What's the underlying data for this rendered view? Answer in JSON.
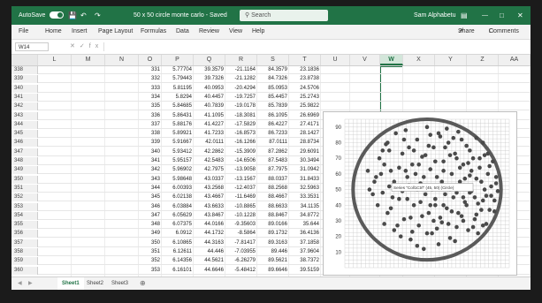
{
  "app": {
    "autosave_label": "AutoSave",
    "toggle_state": "On",
    "title": "50 x 50 circle monte carlo - Saved",
    "search_placeholder": "Search",
    "user": "Sam Alphabetu"
  },
  "menu": [
    "File",
    "Home",
    "Insert",
    "Page Layout",
    "Formulas",
    "Data",
    "Review",
    "View",
    "Help"
  ],
  "share_label": "Share",
  "comments_label": "Comments",
  "formula_bar": {
    "name_box": "W14",
    "formula": ""
  },
  "columns": [
    "L",
    "M",
    "N",
    "O",
    "P",
    "Q",
    "R",
    "S",
    "T",
    "U",
    "V",
    "W",
    "X",
    "Y",
    "Z",
    "AA"
  ],
  "selected_column": "W",
  "rows": [
    {
      "n": "338",
      "o": "331",
      "p": "5.77704",
      "q": "39.3579",
      "r": "-21.1164",
      "s": "84.3579",
      "t": "23.1836"
    },
    {
      "n": "339",
      "o": "332",
      "p": "5.79443",
      "q": "39.7326",
      "r": "-21.1282",
      "s": "84.7326",
      "t": "23.8738"
    },
    {
      "n": "340",
      "o": "333",
      "p": "5.81195",
      "q": "40.0953",
      "r": "-20.4294",
      "s": "85.0953",
      "t": "24.5706"
    },
    {
      "n": "341",
      "o": "334",
      "p": "5.8294",
      "q": "40.4457",
      "r": "-19.7257",
      "s": "85.4457",
      "t": "25.2743"
    },
    {
      "n": "342",
      "o": "335",
      "p": "5.84685",
      "q": "40.7839",
      "r": "-19.0178",
      "s": "85.7839",
      "t": "25.9822"
    },
    {
      "n": "343",
      "o": "336",
      "p": "5.86431",
      "q": "41.1095",
      "r": "-18.3081",
      "s": "86.1095",
      "t": "26.6969"
    },
    {
      "n": "344",
      "o": "337",
      "p": "5.88176",
      "q": "41.4227",
      "r": "-17.5829",
      "s": "86.4227",
      "t": "27.4171"
    },
    {
      "n": "345",
      "o": "338",
      "p": "5.89921",
      "q": "41.7233",
      "r": "-16.8573",
      "s": "86.7233",
      "t": "28.1427"
    },
    {
      "n": "346",
      "o": "339",
      "p": "5.91667",
      "q": "42.0111",
      "r": "-16.1266",
      "s": "87.0111",
      "t": "28.8734"
    },
    {
      "n": "347",
      "o": "340",
      "p": "5.93412",
      "q": "42.2862",
      "r": "-15.3909",
      "s": "87.2862",
      "t": "29.6091"
    },
    {
      "n": "348",
      "o": "341",
      "p": "5.95157",
      "q": "42.5483",
      "r": "-14.6506",
      "s": "87.5483",
      "t": "30.3494"
    },
    {
      "n": "349",
      "o": "342",
      "p": "5.96902",
      "q": "42.7975",
      "r": "-13.9058",
      "s": "87.7975",
      "t": "31.0942"
    },
    {
      "n": "350",
      "o": "343",
      "p": "5.98648",
      "q": "43.0337",
      "r": "-13.1567",
      "s": "88.0337",
      "t": "31.8433"
    },
    {
      "n": "351",
      "o": "344",
      "p": "6.00393",
      "q": "43.2568",
      "r": "-12.4037",
      "s": "88.2568",
      "t": "32.5963"
    },
    {
      "n": "352",
      "o": "345",
      "p": "6.02138",
      "q": "43.4667",
      "r": "-11.6469",
      "s": "88.4667",
      "t": "33.3531"
    },
    {
      "n": "353",
      "o": "346",
      "p": "6.03884",
      "q": "43.6633",
      "r": "-10.8865",
      "s": "88.6633",
      "t": "34.1135"
    },
    {
      "n": "354",
      "o": "347",
      "p": "6.05629",
      "q": "43.8467",
      "r": "-10.1228",
      "s": "88.8467",
      "t": "34.8772"
    },
    {
      "n": "355",
      "o": "348",
      "p": "6.07375",
      "q": "44.0166",
      "r": "-9.35603",
      "s": "89.0166",
      "t": "35.644"
    },
    {
      "n": "356",
      "o": "349",
      "p": "6.0912",
      "q": "44.1732",
      "r": "-8.5864",
      "s": "89.1732",
      "t": "36.4136"
    },
    {
      "n": "357",
      "o": "350",
      "p": "6.10865",
      "q": "44.3163",
      "r": "-7.81417",
      "s": "89.3163",
      "t": "37.1858"
    },
    {
      "n": "358",
      "o": "351",
      "p": "6.12611",
      "q": "44.446",
      "r": "-7.03955",
      "s": "89.446",
      "t": "37.9604"
    },
    {
      "n": "359",
      "o": "352",
      "p": "6.14356",
      "q": "44.5621",
      "r": "-6.26279",
      "s": "89.5621",
      "t": "38.7372"
    },
    {
      "n": "360",
      "o": "353",
      "p": "6.16101",
      "q": "44.6646",
      "r": "-5.48412",
      "s": "89.6646",
      "t": "39.5159"
    }
  ],
  "chart_data": {
    "type": "scatter",
    "yticks": [
      90,
      80,
      70,
      60,
      50,
      40,
      30,
      20,
      10
    ],
    "ylim": [
      0,
      95
    ],
    "xlim": [
      0,
      100
    ],
    "circle": {
      "cx": 50,
      "cy": 50,
      "r": 45
    },
    "tooltip": "Series \"Coll1Ctrl\" (45, 50) (Circle)",
    "points": [
      [
        14,
        62
      ],
      [
        18,
        55
      ],
      [
        21,
        70
      ],
      [
        23,
        48
      ],
      [
        25,
        79
      ],
      [
        26,
        35
      ],
      [
        28,
        62
      ],
      [
        30,
        24
      ],
      [
        31,
        86
      ],
      [
        32,
        52
      ],
      [
        33,
        44
      ],
      [
        35,
        73
      ],
      [
        36,
        31
      ],
      [
        37,
        88
      ],
      [
        38,
        58
      ],
      [
        40,
        18
      ],
      [
        41,
        66
      ],
      [
        42,
        40
      ],
      [
        44,
        82
      ],
      [
        45,
        27
      ],
      [
        46,
        54
      ],
      [
        47,
        71
      ],
      [
        48,
        12
      ],
      [
        49,
        47
      ],
      [
        50,
        90
      ],
      [
        51,
        35
      ],
      [
        52,
        63
      ],
      [
        53,
        22
      ],
      [
        54,
        77
      ],
      [
        55,
        44
      ],
      [
        56,
        58
      ],
      [
        57,
        15
      ],
      [
        58,
        84
      ],
      [
        59,
        29
      ],
      [
        60,
        68
      ],
      [
        61,
        51
      ],
      [
        62,
        38
      ],
      [
        63,
        80
      ],
      [
        64,
        19
      ],
      [
        65,
        60
      ],
      [
        66,
        45
      ],
      [
        67,
        73
      ],
      [
        68,
        26
      ],
      [
        69,
        87
      ],
      [
        70,
        55
      ],
      [
        71,
        33
      ],
      [
        72,
        66
      ],
      [
        73,
        42
      ],
      [
        74,
        78
      ],
      [
        75,
        24
      ],
      [
        76,
        59
      ],
      [
        77,
        49
      ],
      [
        78,
        70
      ],
      [
        79,
        31
      ],
      [
        80,
        83
      ],
      [
        81,
        41
      ],
      [
        82,
        64
      ],
      [
        83,
        55
      ],
      [
        84,
        27
      ],
      [
        85,
        72
      ],
      [
        86,
        46
      ],
      [
        87,
        60
      ],
      [
        88,
        37
      ],
      [
        89,
        52
      ],
      [
        90,
        68
      ],
      [
        91,
        43
      ],
      [
        92,
        58
      ],
      [
        93,
        49
      ],
      [
        20,
        40
      ],
      [
        22,
        60
      ],
      [
        24,
        28
      ],
      [
        27,
        75
      ],
      [
        29,
        45
      ],
      [
        34,
        20
      ],
      [
        39,
        77
      ],
      [
        43,
        60
      ],
      [
        47,
        33
      ],
      [
        52,
        85
      ],
      [
        56,
        25
      ],
      [
        60,
        40
      ],
      [
        64,
        72
      ],
      [
        68,
        48
      ],
      [
        72,
        30
      ],
      [
        76,
        75
      ],
      [
        80,
        57
      ],
      [
        84,
        43
      ],
      [
        88,
        65
      ],
      [
        91,
        36
      ],
      [
        17,
        47
      ],
      [
        26,
        80
      ],
      [
        33,
        64
      ],
      [
        41,
        23
      ],
      [
        49,
        72
      ],
      [
        58,
        32
      ],
      [
        66,
        83
      ],
      [
        74,
        40
      ],
      [
        82,
        70
      ],
      [
        86,
        28
      ],
      [
        30,
        55
      ],
      [
        38,
        44
      ],
      [
        45,
        66
      ],
      [
        53,
        50
      ],
      [
        61,
        77
      ],
      [
        69,
        35
      ],
      [
        77,
        62
      ],
      [
        85,
        50
      ],
      [
        28,
        38
      ],
      [
        36,
        82
      ],
      [
        44,
        14
      ],
      [
        55,
        68
      ],
      [
        63,
        28
      ],
      [
        71,
        82
      ],
      [
        79,
        45
      ],
      [
        87,
        73
      ],
      [
        24,
        66
      ],
      [
        32,
        27
      ],
      [
        48,
        58
      ],
      [
        57,
        86
      ],
      [
        65,
        36
      ],
      [
        73,
        57
      ],
      [
        81,
        22
      ],
      [
        89,
        46
      ],
      [
        19,
        58
      ],
      [
        35,
        49
      ],
      [
        42,
        75
      ],
      [
        50,
        22
      ],
      [
        59,
        55
      ],
      [
        67,
        17
      ],
      [
        75,
        67
      ],
      [
        83,
        37
      ],
      [
        92,
        54
      ],
      [
        46,
        42
      ],
      [
        54,
        30
      ],
      [
        62,
        89
      ],
      [
        70,
        64
      ],
      [
        78,
        26
      ],
      [
        27,
        52
      ],
      [
        40,
        32
      ],
      [
        51,
        78
      ],
      [
        60,
        62
      ],
      [
        68,
        70
      ],
      [
        76,
        48
      ],
      [
        84,
        80
      ],
      [
        23,
        75
      ],
      [
        37,
        62
      ],
      [
        55,
        40
      ],
      [
        64,
        50
      ],
      [
        72,
        45
      ],
      [
        80,
        34
      ],
      [
        15,
        50
      ],
      [
        44,
        50
      ],
      [
        52,
        40
      ],
      [
        61,
        47
      ],
      [
        39,
        53
      ]
    ]
  },
  "sheets": [
    "Sheet1",
    "Sheet2",
    "Sheet3"
  ],
  "active_sheet": "Sheet1"
}
